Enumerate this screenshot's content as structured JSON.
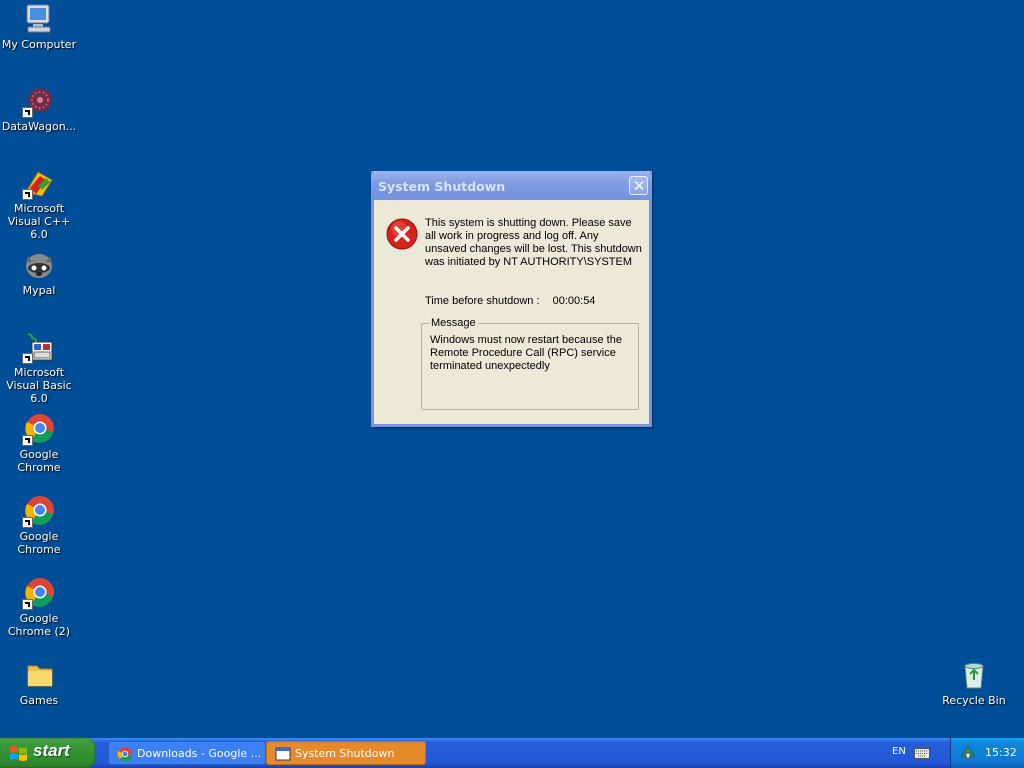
{
  "desktop": {
    "icons": [
      {
        "label": "My Computer",
        "icon": "my-computer-icon"
      },
      {
        "label": "DataWagon...",
        "icon": "datawagon-icon"
      },
      {
        "label": "Microsoft Visual C++ 6.0",
        "icon": "visual-cpp-icon"
      },
      {
        "label": "Mypal",
        "icon": "mypal-icon"
      },
      {
        "label": "Microsoft Visual Basic 6.0",
        "icon": "visual-basic-icon"
      },
      {
        "label": "Google Chrome",
        "icon": "chrome-icon"
      },
      {
        "label": "Google Chrome",
        "icon": "chrome-icon"
      },
      {
        "label": "Google Chrome (2)",
        "icon": "chrome-icon"
      },
      {
        "label": "Games",
        "icon": "folder-icon"
      },
      {
        "label": "Recycle Bin",
        "icon": "recycle-bin-icon"
      }
    ]
  },
  "dialog": {
    "title": "System Shutdown",
    "message": "This system is shutting down. Please save all work in progress and log off. Any unsaved changes will be lost. This shutdown was initiated by NT AUTHORITY\\SYSTEM",
    "time_label": "Time before shutdown :",
    "time_value": "00:00:54",
    "group_label": "Message",
    "group_text": "Windows must now restart because the Remote Procedure Call (RPC) service terminated unexpectedly"
  },
  "taskbar": {
    "start_label": "start",
    "tasks": [
      {
        "label": "Downloads - Google ...",
        "icon": "chrome-icon"
      },
      {
        "label": "System Shutdown",
        "icon": "window-icon"
      }
    ],
    "language": "EN",
    "clock": "15:32"
  }
}
